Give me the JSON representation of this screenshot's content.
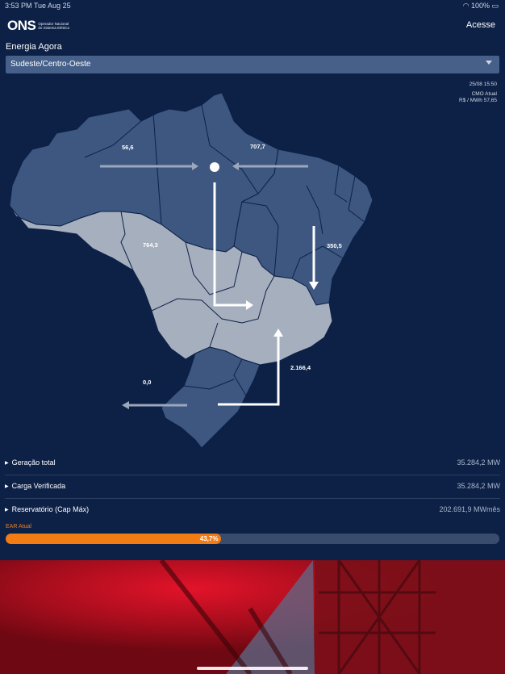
{
  "status_bar": {
    "time": "3:53 PM",
    "date": "Tue Aug 25",
    "battery": "100%"
  },
  "header": {
    "logo_mark": "ONS",
    "logo_text": "Operador Nacional do Sistema Elétrico",
    "login_label": "Acesse"
  },
  "section_title": "Energia Agora",
  "region_select": {
    "selected": "Sudeste/Centro-Oeste"
  },
  "info": {
    "timestamp": "25/08 15:50",
    "cmo_label": "CMO Atual",
    "cmo_value": "R$ / MWh 57,65"
  },
  "flows": {
    "north_west": "56,6",
    "north_east": "707,7",
    "center_west": "764,3",
    "northeast": "350,5",
    "south": "2.166,4",
    "southwest": "0,0"
  },
  "stats": [
    {
      "label": "Geração total",
      "value": "35.284,2 MW"
    },
    {
      "label": "Carga Verificada",
      "value": "35.284,2 MW"
    },
    {
      "label": "Reservatório (Cap Máx)",
      "value": "202.691,9 MWmês"
    }
  ],
  "ear": {
    "label": "EAR Atual",
    "percent_text": "43,7%",
    "fraction": 0.437
  },
  "colors": {
    "background": "#0d2147",
    "region_dark": "#3d5780",
    "region_light": "#a6afbe",
    "accent": "#f27c14"
  }
}
